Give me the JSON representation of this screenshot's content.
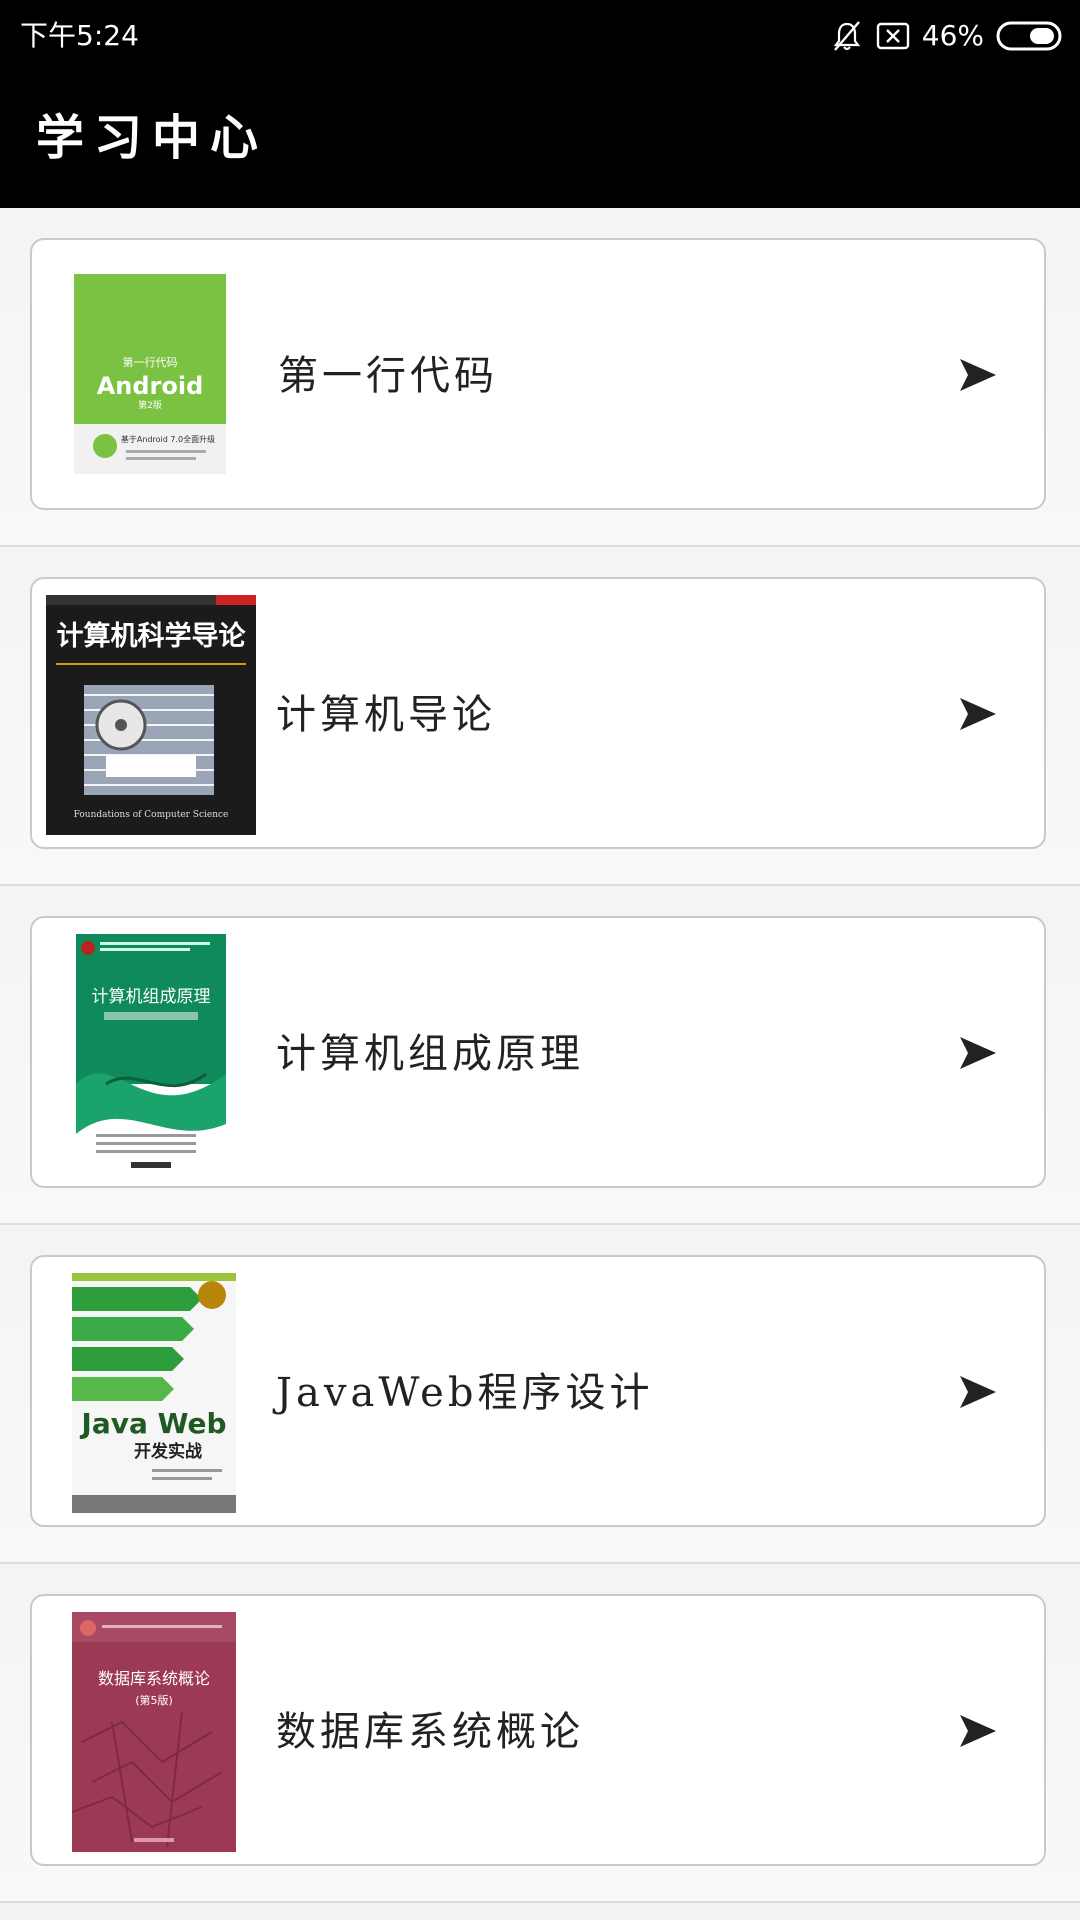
{
  "status_bar": {
    "time": "下午5:24",
    "battery_percent": "46%",
    "icons": [
      "bell-off-icon",
      "no-sim-icon",
      "battery-icon"
    ]
  },
  "app_bar": {
    "title": "学习中心"
  },
  "books": [
    {
      "title": "第一行代码",
      "cover": {
        "icon": "book-cover-android",
        "color": "#7bc142",
        "text": [
          "第一行代码",
          "Android",
          "第2版",
          "基于Android 7.0全面升级"
        ]
      }
    },
    {
      "title": "计算机导论",
      "cover": {
        "icon": "book-cover-cs-intro",
        "color": "#1b1b1b",
        "text": [
          "计算机科学导论",
          "Foundations of Computer Science"
        ]
      }
    },
    {
      "title": "计算机组成原理",
      "cover": {
        "icon": "book-cover-organization",
        "color": "#0f8a5a",
        "text": [
          "计算机组成原理"
        ]
      }
    },
    {
      "title": "JavaWeb程序设计",
      "cover": {
        "icon": "book-cover-javaweb",
        "color": "#2e9e3c",
        "text": [
          "Java Web",
          "开发实战"
        ]
      }
    },
    {
      "title": "数据库系统概论",
      "cover": {
        "icon": "book-cover-database",
        "color": "#9c3a55",
        "text": [
          "数据库系统概论",
          "(第5版)"
        ]
      }
    }
  ]
}
